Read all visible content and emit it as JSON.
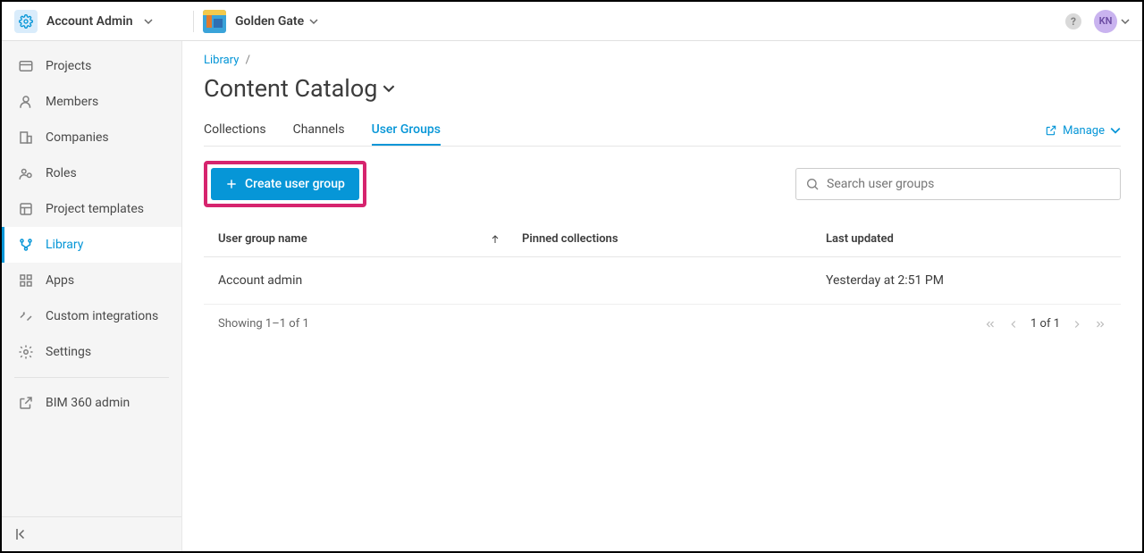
{
  "header": {
    "account_label": "Account Admin",
    "project_name": "Golden Gate",
    "help_char": "?",
    "avatar_initials": "KN"
  },
  "sidebar": {
    "items": [
      {
        "label": "Projects"
      },
      {
        "label": "Members"
      },
      {
        "label": "Companies"
      },
      {
        "label": "Roles"
      },
      {
        "label": "Project templates"
      },
      {
        "label": "Library"
      },
      {
        "label": "Apps"
      },
      {
        "label": "Custom integrations"
      },
      {
        "label": "Settings"
      },
      {
        "label": "BIM 360 admin"
      }
    ]
  },
  "breadcrumb": {
    "root": "Library",
    "sep": "/"
  },
  "page_title": "Content Catalog",
  "tabs": [
    {
      "label": "Collections"
    },
    {
      "label": "Channels"
    },
    {
      "label": "User Groups"
    }
  ],
  "manage_label": "Manage",
  "toolbar": {
    "create_label": "Create user group",
    "search_placeholder": "Search user groups"
  },
  "table": {
    "columns": {
      "name": "User group name",
      "pinned": "Pinned collections",
      "updated": "Last updated"
    },
    "rows": [
      {
        "name": "Account admin",
        "pinned": "",
        "updated": "Yesterday at 2:51 PM"
      }
    ],
    "footer_text": "Showing 1–1 of 1",
    "page_info": "1 of 1"
  }
}
